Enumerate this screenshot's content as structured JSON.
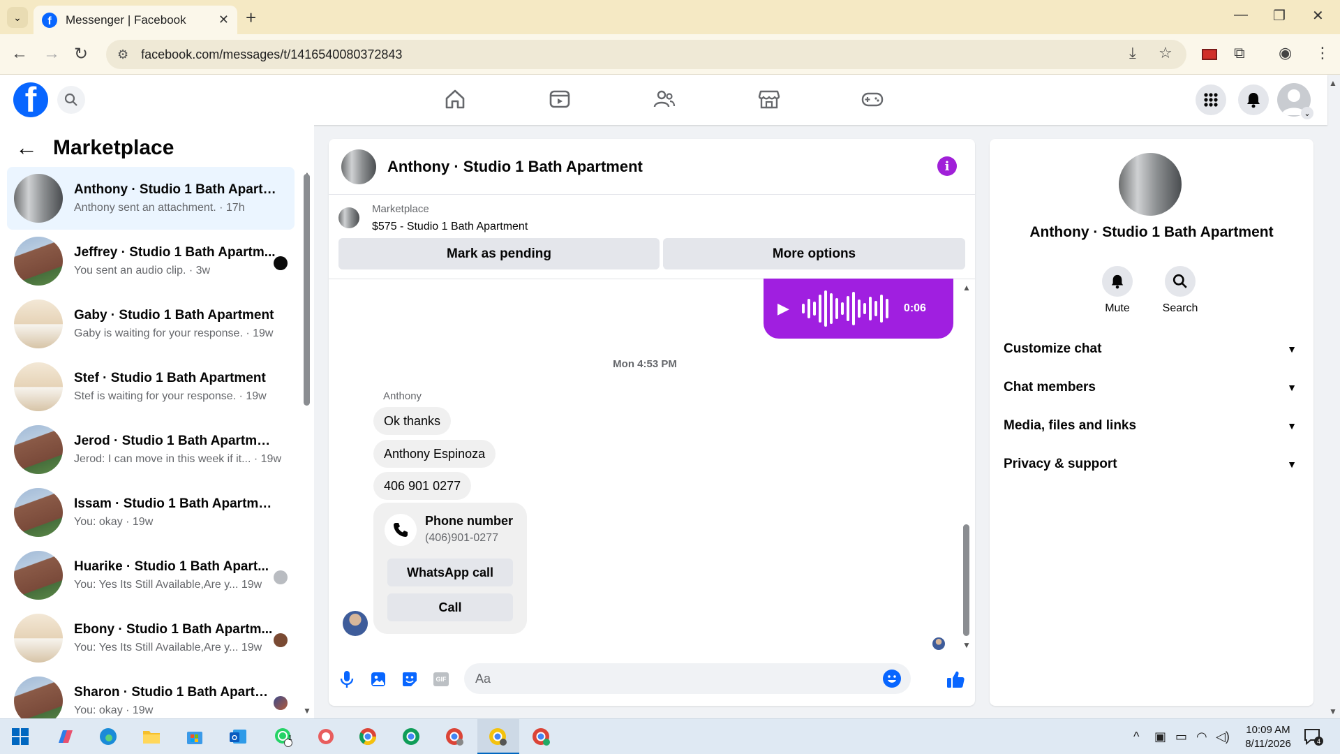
{
  "browser": {
    "tab_title": "Messenger | Facebook",
    "url": "facebook.com/messages/t/1416540080372843"
  },
  "marketplace": {
    "title": "Marketplace",
    "conversations": [
      {
        "name": "Anthony · Studio 1 Bath Apartm...",
        "preview": "Anthony sent an attachment. · 17h",
        "avatar": "door",
        "indicator": "none",
        "active": true
      },
      {
        "name": "Jeffrey · Studio 1 Bath Apartm...",
        "preview": "You sent an audio clip. · 3w",
        "avatar": "building",
        "indicator": "unread-dot"
      },
      {
        "name": "Gaby · Studio 1 Bath Apartment",
        "preview": "Gaby is waiting for your response. · 19w",
        "avatar": "room",
        "indicator": "none"
      },
      {
        "name": "Stef · Studio 1 Bath Apartment",
        "preview": "Stef is waiting for your response. · 19w",
        "avatar": "room",
        "indicator": "none"
      },
      {
        "name": "Jerod · Studio 1 Bath Apartment",
        "preview": "Jerod: I can move in this week if it... · 19w",
        "avatar": "building",
        "indicator": "none"
      },
      {
        "name": "Issam · Studio 1 Bath Apartment",
        "preview": "You: okay · 19w",
        "avatar": "building",
        "indicator": "none"
      },
      {
        "name": "Huarike · Studio 1 Bath Apart...",
        "preview": "You: Yes Its Still Available,Are y... 19w",
        "avatar": "building",
        "indicator": "seen-grey"
      },
      {
        "name": "Ebony · Studio 1 Bath Apartm...",
        "preview": "You: Yes Its Still Available,Are y... 19w",
        "avatar": "room",
        "indicator": "seen-brown"
      },
      {
        "name": "Sharon · Studio 1 Bath Apartm...",
        "preview": "You: okay · 19w",
        "avatar": "building",
        "indicator": "seen-mix"
      }
    ]
  },
  "chat": {
    "title": "Anthony · Studio 1 Bath Apartment",
    "marketplace_label": "Marketplace",
    "listing": "$575 - Studio 1 Bath Apartment",
    "mark_pending": "Mark as pending",
    "more_options": "More options",
    "audio_duration": "0:06",
    "timestamp": "Mon 4:53 PM",
    "sender": "Anthony",
    "messages": [
      "Ok thanks",
      "Anthony Espinoza",
      "406 901 0277"
    ],
    "phone_card": {
      "title": "Phone number",
      "number": "(406)901-0277",
      "whatsapp": "WhatsApp call",
      "call": "Call"
    },
    "composer_placeholder": "Aa"
  },
  "info_panel": {
    "name": "Anthony · Studio 1 Bath Apartment",
    "mute": "Mute",
    "search": "Search",
    "sections": [
      "Customize chat",
      "Chat members",
      "Media, files and links",
      "Privacy & support"
    ]
  },
  "taskbar": {
    "time": "10:09 AM",
    "date": "8/11/2026",
    "whatsapp_badge": "1",
    "notif_count": "4"
  },
  "colors": {
    "accent": "#0866ff",
    "messenger_purple": "#a01fe0",
    "active_row": "#ebf5ff"
  }
}
